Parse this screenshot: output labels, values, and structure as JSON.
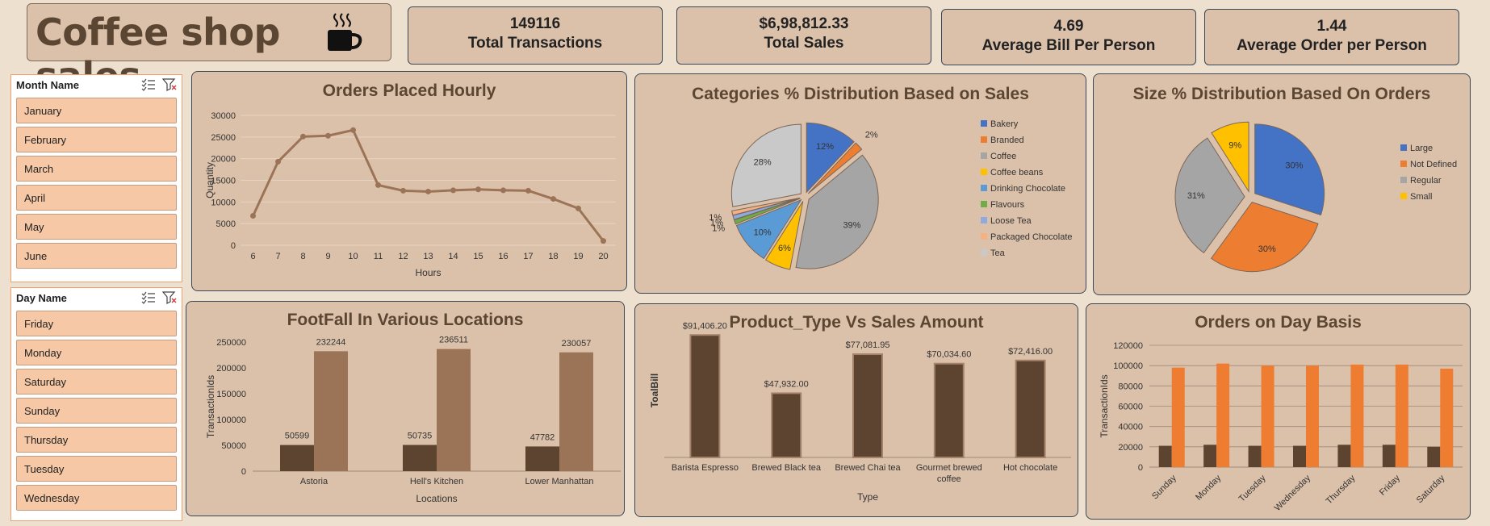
{
  "header": {
    "title": "Coffee shop sales"
  },
  "kpis": [
    {
      "value": "149116",
      "label": "Total Transactions"
    },
    {
      "value": "$6,98,812.33",
      "label": "Total Sales"
    },
    {
      "value": "4.69",
      "label": "Average Bill Per Person"
    },
    {
      "value": "1.44",
      "label": "Average Order per Person"
    }
  ],
  "slicers": {
    "month": {
      "title": "Month Name",
      "items": [
        "January",
        "February",
        "March",
        "April",
        "May",
        "June"
      ]
    },
    "day": {
      "title": "Day Name",
      "items": [
        "Friday",
        "Monday",
        "Saturday",
        "Sunday",
        "Thursday",
        "Tuesday",
        "Wednesday"
      ]
    }
  },
  "colors": {
    "line": "#9b7458",
    "barDark": "#5c4430",
    "barLight": "#9b7458",
    "orange": "#ee7d31",
    "panel": "#dcc1aa"
  },
  "chart_data": [
    {
      "type": "line",
      "title": "Orders Placed Hourly",
      "xlabel": "Hours",
      "ylabel": "Quantity",
      "x": [
        6,
        7,
        8,
        9,
        10,
        11,
        12,
        13,
        14,
        15,
        16,
        17,
        18,
        19,
        20
      ],
      "values": [
        6800,
        19300,
        25100,
        25300,
        26600,
        13900,
        12600,
        12400,
        12700,
        12900,
        12700,
        12600,
        10700,
        8500,
        1000
      ],
      "ylim": [
        0,
        30000
      ],
      "yticks": [
        0,
        5000,
        10000,
        15000,
        20000,
        25000,
        30000
      ],
      "grid": true
    },
    {
      "type": "pie",
      "title": "Categories % Distribution Based on Sales",
      "categories": [
        "Bakery",
        "Branded",
        "Coffee",
        "Coffee beans",
        "Drinking Chocolate",
        "Flavours",
        "Loose Tea",
        "Packaged Chocolate",
        "Tea"
      ],
      "values": [
        12,
        2,
        39,
        6,
        10,
        1,
        1,
        1,
        28
      ],
      "labels": [
        "12%",
        "2%",
        "39%",
        "6%",
        "10%",
        "1%",
        "1%",
        "1%",
        "28%"
      ],
      "colors": [
        "#4472c4",
        "#ed7d31",
        "#a5a5a5",
        "#ffc000",
        "#5b9bd5",
        "#70ad47",
        "#8faadc",
        "#f4b183",
        "#c9c9c9"
      ],
      "legend": "right"
    },
    {
      "type": "pie",
      "title": "Size % Distribution Based On Orders",
      "categories": [
        "Large",
        "Not Defined",
        "Regular",
        "Small"
      ],
      "values": [
        30,
        30,
        31,
        9
      ],
      "labels": [
        "30%",
        "30%",
        "31%",
        "9%"
      ],
      "colors": [
        "#4472c4",
        "#ed7d31",
        "#a5a5a5",
        "#ffc000"
      ],
      "legend": "right"
    },
    {
      "type": "bar",
      "title": "FootFall In Various Locations",
      "xlabel": "Locations",
      "ylabel": "TransactionIds",
      "categories": [
        "Astoria",
        "Hell's Kitchen",
        "Lower Manhattan"
      ],
      "series": [
        {
          "values": [
            50599,
            50735,
            47782
          ]
        },
        {
          "values": [
            232244,
            236511,
            230057
          ]
        }
      ],
      "ylim": [
        0,
        250000
      ],
      "yticks": [
        0,
        50000,
        100000,
        150000,
        200000,
        250000
      ]
    },
    {
      "type": "bar",
      "title": "Product_Type Vs Sales Amount",
      "xlabel": "Type",
      "ylabel": "ToalBill",
      "categories": [
        "Barista Espresso",
        "Brewed Black tea",
        "Brewed Chai tea",
        "Gourmet brewed coffee",
        "Hot chocolate"
      ],
      "values": [
        91406.2,
        47932.0,
        77081.95,
        70034.6,
        72416.0
      ],
      "labels": [
        "$91,406.20",
        "$47,932.00",
        "$77,081.95",
        "$70,034.60",
        "$72,416.00"
      ],
      "ylim": [
        0,
        100000
      ]
    },
    {
      "type": "bar",
      "title": "Orders on Day Basis",
      "ylabel": "TransactionIds",
      "categories": [
        "Sunday",
        "Monday",
        "Tuesday",
        "Wednesday",
        "Thursday",
        "Friday",
        "Saturday"
      ],
      "series": [
        {
          "values": [
            21000,
            22000,
            21000,
            21000,
            22000,
            22000,
            20000
          ]
        },
        {
          "values": [
            98000,
            102000,
            100000,
            100000,
            101000,
            101000,
            97000
          ]
        }
      ],
      "ylim": [
        0,
        120000
      ],
      "yticks": [
        0,
        20000,
        40000,
        60000,
        80000,
        100000,
        120000
      ],
      "grid": true
    }
  ]
}
